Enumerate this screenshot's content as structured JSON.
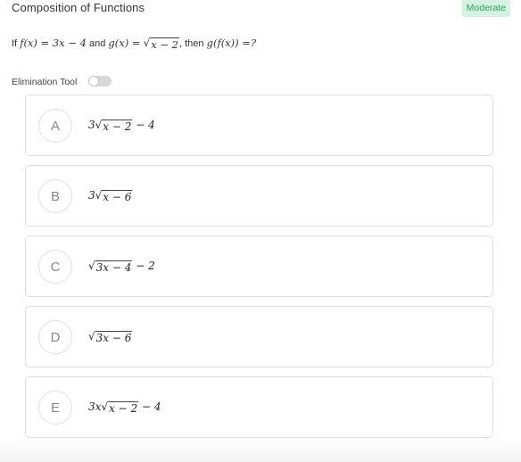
{
  "header": {
    "title": "Composition of Functions",
    "difficulty": "Moderate"
  },
  "question": {
    "prefix": "If",
    "f_def": "f(x) = 3x − 4",
    "and_word": "and",
    "g_lhs": "g(x) =",
    "g_radicand": "x − 2",
    "then_text": ", then",
    "ask": "g(f(x)) =?"
  },
  "elimination_tool": {
    "label": "Elimination Tool",
    "enabled": false
  },
  "choices": [
    {
      "letter": "A",
      "before": "3",
      "radicand": "x − 2",
      "after": " − 4"
    },
    {
      "letter": "B",
      "before": "3",
      "radicand": "x − 6",
      "after": ""
    },
    {
      "letter": "C",
      "before": "",
      "radicand": "3x − 4",
      "after": " − 2"
    },
    {
      "letter": "D",
      "before": "",
      "radicand": "3x − 6",
      "after": ""
    },
    {
      "letter": "E",
      "before": "3x",
      "radicand": "x − 2",
      "after": " − 4"
    }
  ],
  "colors": {
    "badge_bg": "#d5f3e1",
    "badge_text": "#2aa35f",
    "choice_border": "#dedede"
  }
}
